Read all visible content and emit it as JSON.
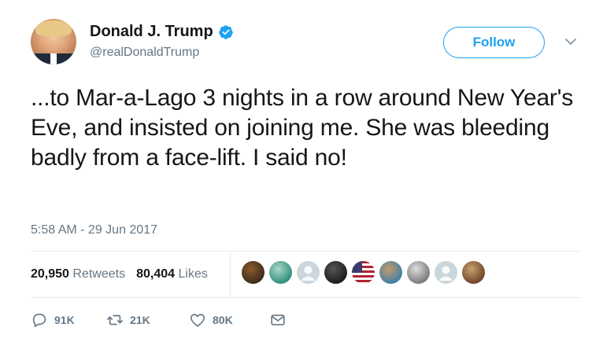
{
  "author": {
    "name": "Donald J. Trump",
    "handle": "@realDonaldTrump",
    "verified": true
  },
  "follow_button": {
    "label": "Follow"
  },
  "tweet": {
    "text": "...to Mar-a-Lago 3 nights in a row around New Year's Eve, and insisted on joining me. She was bleeding badly from a face-lift. I said no!",
    "timestamp": "5:58 AM - 29 Jun 2017"
  },
  "stats": {
    "retweets_count": "20,950",
    "retweets_label": "Retweets",
    "likes_count": "80,404",
    "likes_label": "Likes"
  },
  "likers": [
    {
      "kind": "photo",
      "colors": [
        "#3a2a1c",
        "#8b5a2b"
      ]
    },
    {
      "kind": "photo",
      "colors": [
        "#2e8b7a",
        "#a8d8c8"
      ]
    },
    {
      "kind": "default",
      "colors": [
        "#ccd6dd",
        "#aab8c2"
      ]
    },
    {
      "kind": "photo",
      "colors": [
        "#1a1a1a",
        "#555555"
      ]
    },
    {
      "kind": "flag",
      "colors": [
        "#b22234",
        "#3c3b6e"
      ]
    },
    {
      "kind": "photo",
      "colors": [
        "#3d7fa8",
        "#c49a6c"
      ]
    },
    {
      "kind": "photo",
      "colors": [
        "#777777",
        "#dddddd"
      ]
    },
    {
      "kind": "default",
      "colors": [
        "#ccd6dd",
        "#aab8c2"
      ]
    },
    {
      "kind": "photo",
      "colors": [
        "#6b4226",
        "#c8a070"
      ]
    }
  ],
  "actions": {
    "reply_count": "91K",
    "retweet_count": "21K",
    "like_count": "80K"
  },
  "colors": {
    "accent": "#1da1f2",
    "secondary_text": "#657786",
    "primary_text": "#14171a",
    "divider": "#e6ecf0"
  }
}
